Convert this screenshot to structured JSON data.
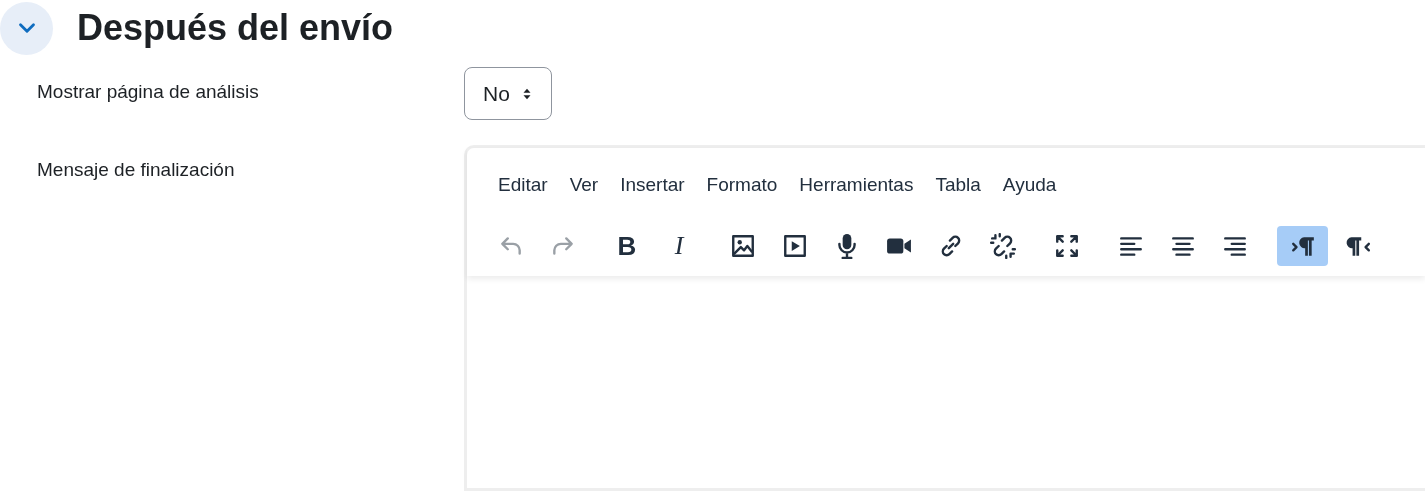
{
  "section": {
    "title": "Después del envío",
    "expanded": true
  },
  "fields": [
    {
      "kind": "select",
      "label": "Mostrar página de análisis",
      "value": "No"
    },
    {
      "kind": "editor",
      "label": "Mensaje de finalización",
      "menu": [
        "Editar",
        "Ver",
        "Insertar",
        "Formato",
        "Herramientas",
        "Tabla",
        "Ayuda"
      ],
      "toolbar": [
        [
          {
            "kind": "undo",
            "disabled": true,
            "active": false
          },
          {
            "kind": "redo",
            "disabled": true,
            "active": false
          }
        ],
        [
          {
            "kind": "bold",
            "glyph": "B",
            "disabled": false,
            "active": false
          },
          {
            "kind": "italic",
            "glyph": "I",
            "disabled": false,
            "active": false
          }
        ],
        [
          {
            "kind": "image",
            "disabled": false,
            "active": false
          },
          {
            "kind": "media",
            "disabled": false,
            "active": false
          },
          {
            "kind": "mic",
            "disabled": false,
            "active": false
          },
          {
            "kind": "video",
            "disabled": false,
            "active": false
          },
          {
            "kind": "link",
            "disabled": false,
            "active": false
          },
          {
            "kind": "unlink",
            "disabled": false,
            "active": false
          }
        ],
        [
          {
            "kind": "fullscreen",
            "disabled": false,
            "active": false
          }
        ],
        [
          {
            "kind": "align-left",
            "disabled": false,
            "active": false
          },
          {
            "kind": "align-center",
            "disabled": false,
            "active": false
          },
          {
            "kind": "align-right",
            "disabled": false,
            "active": false
          }
        ],
        [
          {
            "kind": "ltr",
            "disabled": false,
            "active": true
          },
          {
            "kind": "rtl",
            "disabled": false,
            "active": false
          }
        ]
      ]
    }
  ]
}
